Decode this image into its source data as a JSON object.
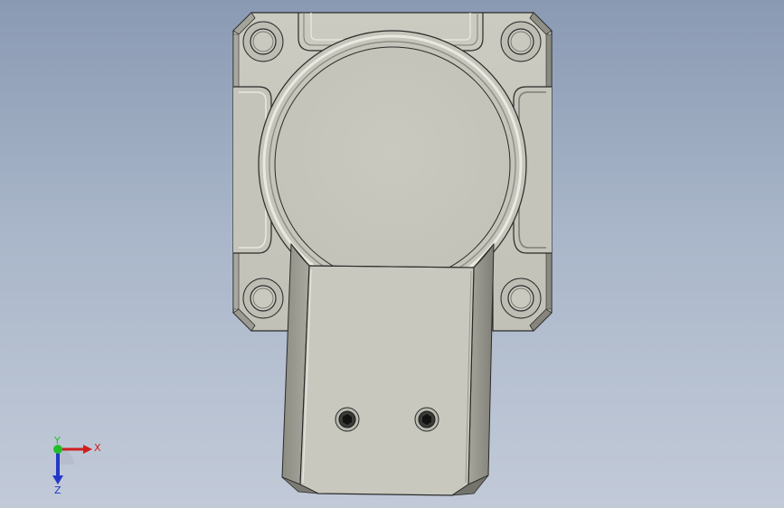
{
  "viewport": {
    "background_top": "#8a9ab3",
    "background_bottom": "#c2cad8"
  },
  "model": {
    "body_color": "#c7c7bd",
    "shade_color": "#9d9d93",
    "dark_color": "#6f6f67",
    "edge_color": "#2a2a2a",
    "mounting_holes": 4,
    "socket_screws": 2
  },
  "triad": {
    "x_label": "X",
    "y_label": "Y",
    "z_label": "Z",
    "x_color": "#d01e1e",
    "y_color": "#1fbf2a",
    "z_color": "#2438c8"
  }
}
